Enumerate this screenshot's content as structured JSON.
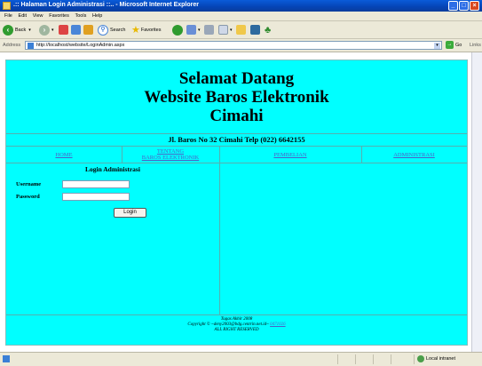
{
  "window": {
    "title": ".:: Halaman Login Administrasi ::.. - Microsoft Internet Explorer",
    "min": "_",
    "max": "□",
    "close": "×"
  },
  "menu": [
    "File",
    "Edit",
    "View",
    "Favorites",
    "Tools",
    "Help"
  ],
  "toolbar": {
    "back_label": "Back",
    "search_label": "Search",
    "favorites_label": "Favorites"
  },
  "address": {
    "label": "Address",
    "url": "http://localhost/website/LoginAdmin.aspx",
    "go_label": "Go",
    "links_label": "Links"
  },
  "page": {
    "header_line1": "Selamat Datang",
    "header_line2": "Website Baros Elektronik",
    "header_line3": "Cimahi",
    "address_line": "Jl. Baros No 32 Cimahi  Telp (022) 6642155",
    "nav": {
      "home": "HOME",
      "tentang_line1": "TENTANG",
      "tentang_line2": "BAROS ELEKTRONIK",
      "pembelian": "PEMBELIAN",
      "administrasi": "ADMINISTRASI"
    },
    "login": {
      "title": "Login Administrasi",
      "username_label": "Username",
      "password_label": "Password",
      "username_value": "",
      "password_value": "",
      "button": "Login"
    },
    "footer": {
      "line1": "Tugas Akhir 2008",
      "line2_prefix": "Copyright © ~deny2003@bdg.centrin.net.id~ ",
      "line2_link": "0471026",
      "line3": "ALL RIGHT RESERVED"
    }
  },
  "status": {
    "zone": "Local intranet"
  },
  "colors": {
    "page_bg": "#00ffff",
    "link": "#4b63c7",
    "titlebar": "#0544b5"
  }
}
